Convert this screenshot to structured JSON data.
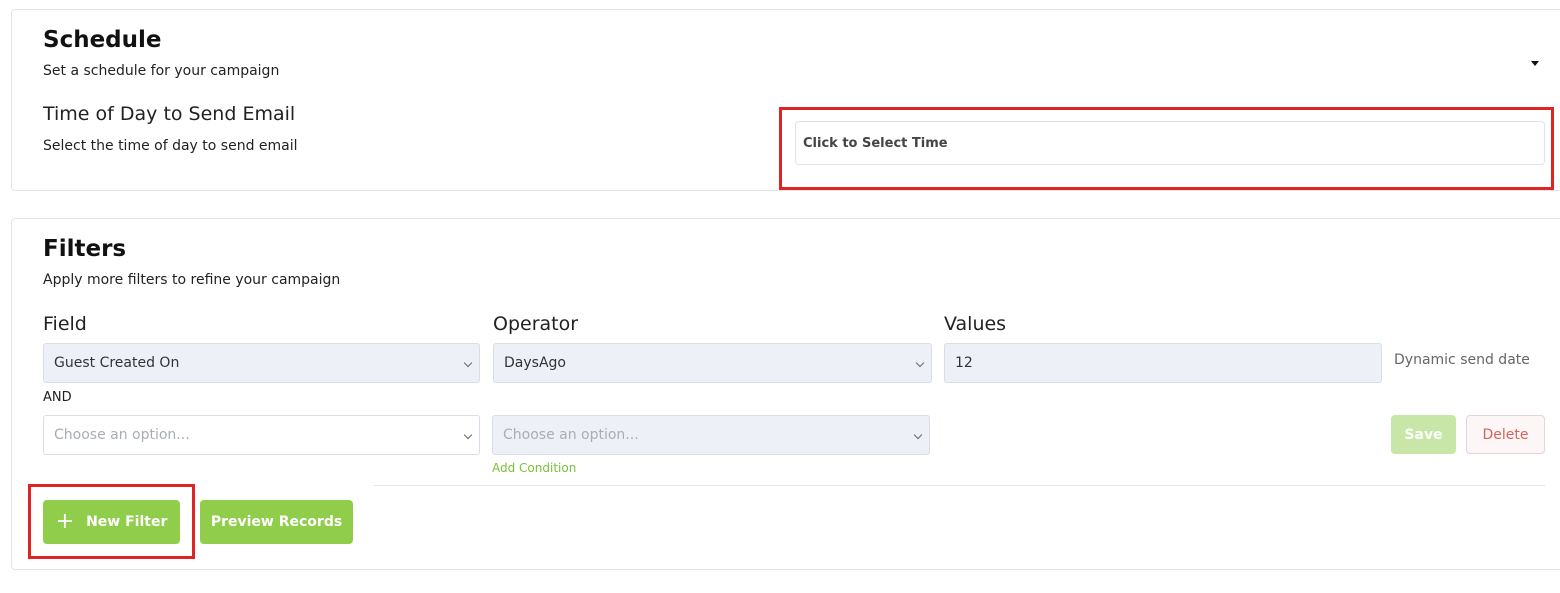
{
  "schedule": {
    "title": "Schedule",
    "subtitle": "Set a schedule for your campaign",
    "time_section": {
      "title": "Time of Day to Send Email",
      "subtitle": "Select the time of day to send email",
      "input_placeholder": "Click to Select Time"
    }
  },
  "filters": {
    "title": "Filters",
    "subtitle": "Apply more filters to refine your campaign",
    "columns": {
      "field": "Field",
      "operator": "Operator",
      "values": "Values"
    },
    "row1": {
      "field": "Guest Created On",
      "operator": "DaysAgo",
      "value": "12",
      "note": "Dynamic send date"
    },
    "conjunction": "AND",
    "row2": {
      "field_placeholder": "Choose an option...",
      "operator_placeholder": "Choose an option..."
    },
    "add_condition_label": "Add Condition",
    "save_label": "Save",
    "delete_label": "Delete",
    "new_filter_label": "New Filter",
    "preview_label": "Preview Records"
  },
  "colors": {
    "accent_green": "#8fcd4b",
    "highlight_red": "#e02424"
  }
}
